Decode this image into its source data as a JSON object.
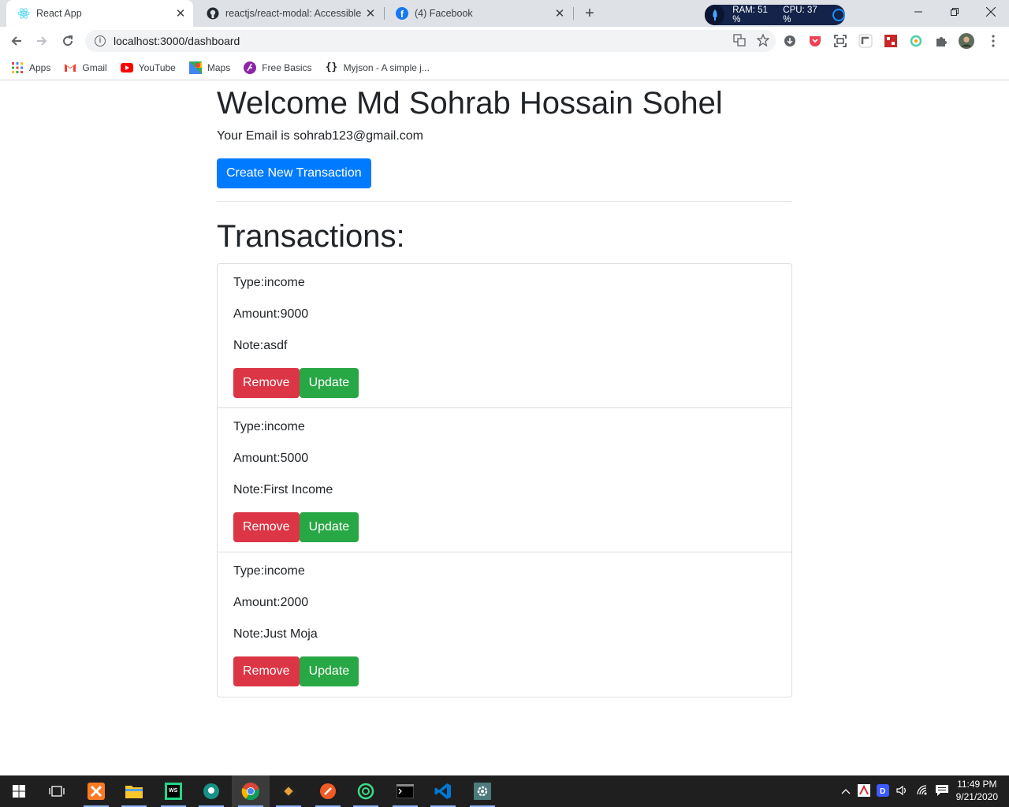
{
  "browser": {
    "tabs": [
      {
        "title": "React App",
        "icon": "react-icon",
        "active": true
      },
      {
        "title": "reactjs/react-modal: Accessible m",
        "icon": "github-icon",
        "active": false
      },
      {
        "title": "(4) Facebook",
        "icon": "facebook-icon",
        "active": false
      }
    ],
    "extension_badge": {
      "ram": "RAM: 51 %",
      "cpu": "CPU: 37 %"
    },
    "url": "localhost:3000/dashboard",
    "bookmarks": [
      {
        "label": "Apps",
        "icon": "apps-grid-icon"
      },
      {
        "label": "Gmail",
        "icon": "gmail-icon"
      },
      {
        "label": "YouTube",
        "icon": "youtube-icon"
      },
      {
        "label": "Maps",
        "icon": "maps-icon"
      },
      {
        "label": "Free Basics",
        "icon": "free-basics-icon"
      },
      {
        "label": "Myjson - A simple j...",
        "icon": "json-braces-icon"
      }
    ]
  },
  "page": {
    "welcome": "Welcome Md Sohrab Hossain Sohel",
    "email_line": "Your Email is sohrab123@gmail.com",
    "create_button": "Create New Transaction",
    "transactions_heading": "Transactions:",
    "transactions": [
      {
        "type": "Type:income",
        "amount": "Amount:9000",
        "note": "Note:asdf"
      },
      {
        "type": "Type:income",
        "amount": "Amount:5000",
        "note": "Note:First Income"
      },
      {
        "type": "Type:income",
        "amount": "Amount:2000",
        "note": "Note:Just Moja"
      }
    ],
    "remove_label": "Remove",
    "update_label": "Update"
  },
  "taskbar": {
    "time": "11:49 PM",
    "date": "9/21/2020"
  },
  "colors": {
    "primary": "#007bff",
    "danger": "#dc3545",
    "success": "#28a745",
    "text": "#212529"
  }
}
